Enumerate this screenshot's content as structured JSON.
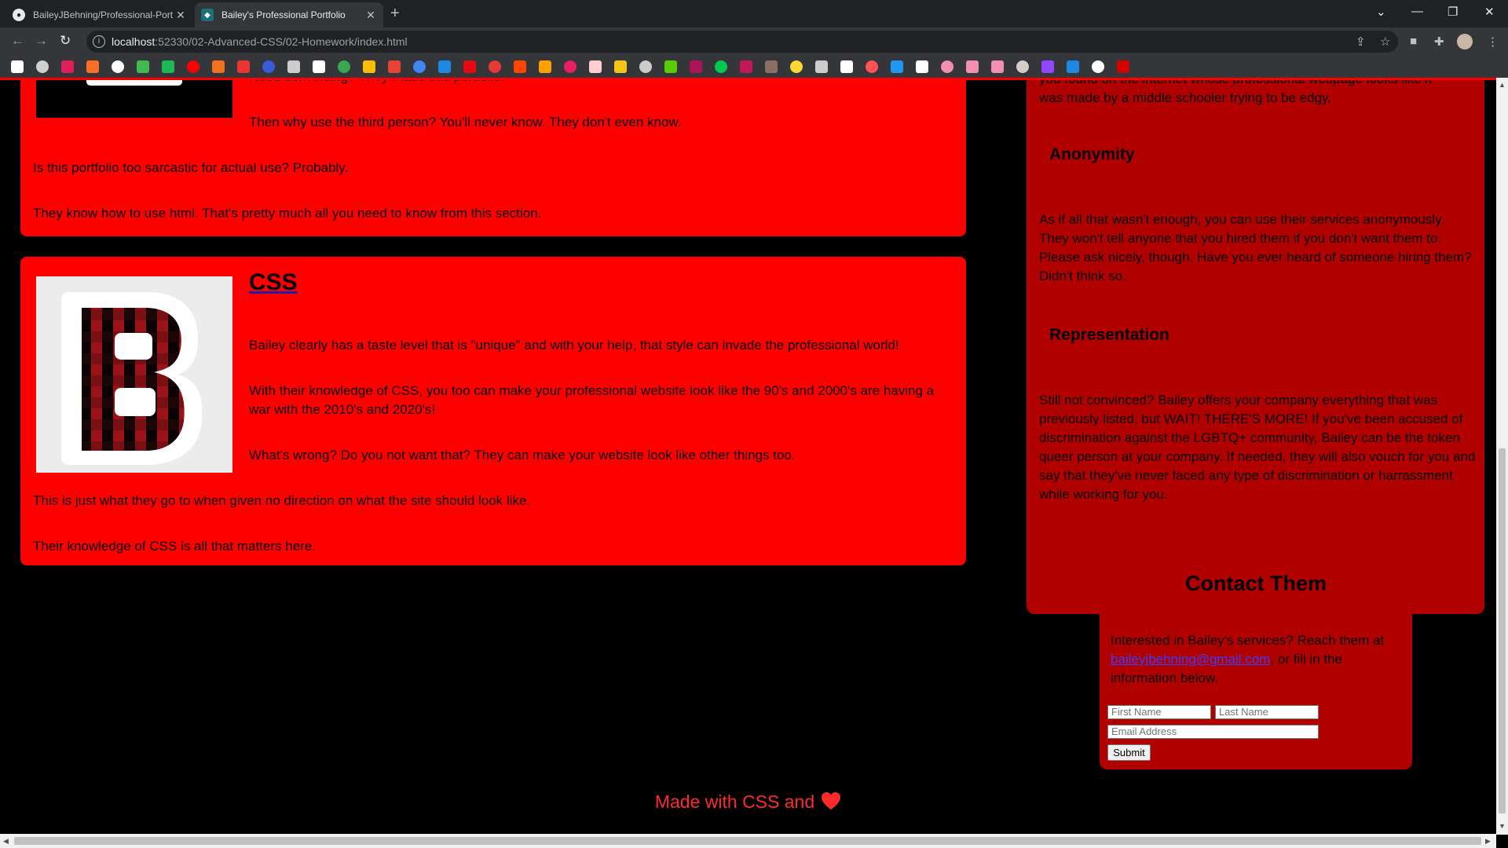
{
  "browser": {
    "tabs": [
      {
        "title": "BaileyJBehning/Professional-Port",
        "active": false
      },
      {
        "title": "Bailey's Professional Portfolio",
        "active": true
      }
    ],
    "url_host": "localhost",
    "url_rest": ":52330/02-Advanced-CSS/02-Homework/index.html"
  },
  "html_section": {
    "p1": "Need convincing? They made this portfolio.",
    "p2": "Then why use the third person? You'll never know. They don't even know.",
    "p3": "Is this portfolio too sarcastic for actual use? Probably.",
    "p4": "They know how to use html. That's pretty much all you need to know from this section."
  },
  "css_section": {
    "title": "CSS",
    "p1": "Bailey clearly has a taste level that is \"unique\" and with your help, that style can invade the professional world!",
    "p2": "With their knowledge of CSS, you too can make your professional website look like the 90's and 2000's are having a war with the 2010's and 2020's!",
    "p3": "What's wrong? Do you not want that? They can make your website look like other things too.",
    "p4": "This is just what they go to when given no direction on what the site should look like.",
    "p5": "Their knowledge of CSS is all that matters here."
  },
  "sidebar": {
    "intro_tail_1": "you found on the internet whose professional webpage looks like it",
    "intro_tail_2": "was made by a middle schooler trying to be edgy.",
    "anonymity_title": "Anonymity",
    "anonymity_text": "As if all that wasn't enough, you can use their services anonymously. They won't tell anyone that you hired them if you don't want them to. Please ask nicely, though. Have you ever heard of someone hiring them? Didn't think so.",
    "representation_title": "Representation",
    "representation_text": "Still not convinced? Bailey offers your company everything that was previously listed, but WAIT! THERE'S MORE! If you've been accused of discrimination against the LGBTQ+ community, Bailey can be the token queer person at your company. If needed, they will also vouch for you and say that they've never faced any type of discrimination or harrassment while working for you."
  },
  "contact": {
    "title": "Contact Them",
    "text_before": "Interested in Bailey's services? Reach them at ",
    "email": "baileyjbehning@gmail.com",
    "text_after": ", or fill in the information below.",
    "first_name_placeholder": "First Name",
    "last_name_placeholder": "Last Name",
    "email_placeholder": "Email Address",
    "submit_label": "Submit"
  },
  "footer": {
    "text": "Made with CSS and"
  },
  "colors": {
    "card_red": "#ff0000",
    "sidebar_red": "#b00000",
    "footer_red": "#ff2a2a",
    "background": "#000000"
  }
}
